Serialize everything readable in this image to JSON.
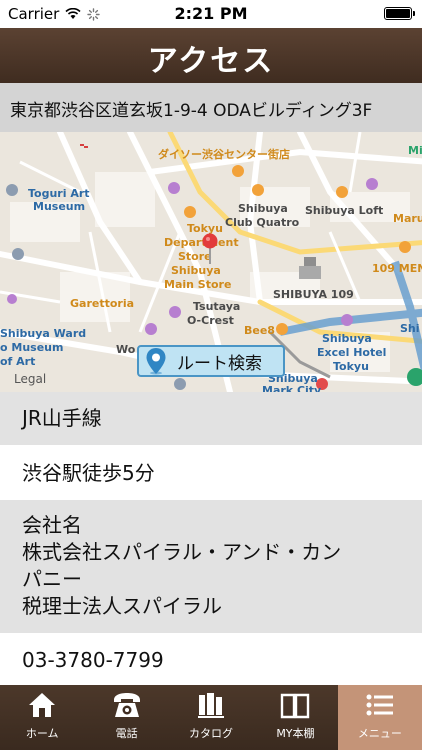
{
  "status": {
    "carrier": "Carrier",
    "time": "2:21 PM"
  },
  "header": {
    "title": "アクセス"
  },
  "address": "東京都渋谷区道玄坂1-9-4 ODAビルディング3F",
  "map": {
    "legal": "Legal",
    "labels": [
      "ダイソー渋谷センター街店",
      "Toguri Art",
      "Museum",
      "Tokyu",
      "Department",
      "Store",
      "Shibuya",
      "Main Store",
      "Shibuya",
      "Club Quatro",
      "Shibuya Loft",
      "Maru",
      "109 MEN",
      "SHIBUYA 109",
      "Garettoria",
      "Tsutaya",
      "O-Crest",
      "Bee8",
      "Shibuya",
      "Excel Hotel",
      "Tokyu",
      "Shibuya",
      "Mark City",
      "Shibuya Ward",
      "o Museum",
      "of Art",
      "Wo",
      "Shi",
      "Mi"
    ],
    "route_button": "ルート検索"
  },
  "info": {
    "line": "JR山手線",
    "walk": "渋谷駅徒歩5分",
    "company_heading": "会社名",
    "company_line1": "株式会社スパイラル・アンド・カン",
    "company_line2": "パニー",
    "company_line3": "税理士法人スパイラル",
    "phone": "03-3780-7799"
  },
  "tabs": [
    {
      "label": "ホーム",
      "icon": "home-icon"
    },
    {
      "label": "電話",
      "icon": "phone-icon"
    },
    {
      "label": "カタログ",
      "icon": "catalog-icon"
    },
    {
      "label": "MY本棚",
      "icon": "bookshelf-icon"
    },
    {
      "label": "メニュー",
      "icon": "menu-icon",
      "active": true
    }
  ],
  "colors": {
    "header": "#4b3628",
    "active_tab": "#c49478",
    "address_bg": "#d4d4d4",
    "row_grey": "#e2e2e2"
  }
}
